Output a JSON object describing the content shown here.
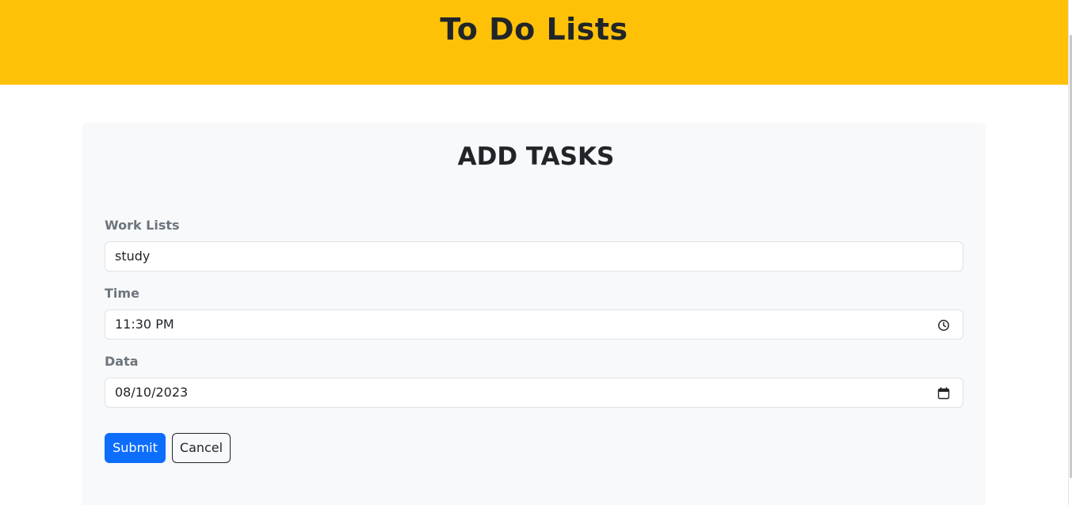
{
  "header": {
    "title": "To Do Lists",
    "background_color": "#ffc107"
  },
  "form": {
    "title": "ADD TASKS",
    "fields": {
      "work_list": {
        "label": "Work Lists",
        "value": "study"
      },
      "time": {
        "label": "Time",
        "value": "11:30 PM",
        "icon": "clock-icon"
      },
      "date": {
        "label": "Data",
        "value": "08/10/2023",
        "icon": "calendar-icon"
      }
    },
    "buttons": {
      "submit_label": "Submit",
      "cancel_label": "Cancel"
    }
  },
  "colors": {
    "accent": "#0d6efd",
    "card_background": "#f8f9fa",
    "label_color": "#6c757d"
  }
}
